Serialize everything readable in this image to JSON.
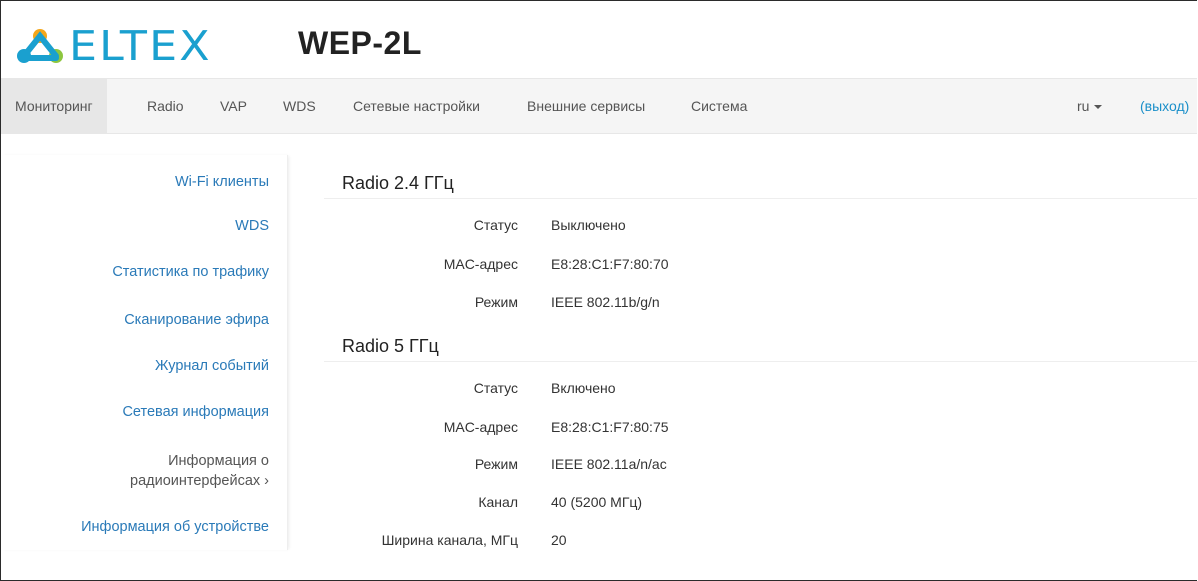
{
  "header": {
    "logo_text": "ELTEX",
    "device_title": "WEP-2L",
    "brand_color": "#1aa0cf"
  },
  "nav": {
    "items": [
      {
        "label": "Мониторинг",
        "active": true
      },
      {
        "label": "Radio",
        "active": false
      },
      {
        "label": "VAP",
        "active": false
      },
      {
        "label": "WDS",
        "active": false
      },
      {
        "label": "Сетевые настройки",
        "active": false
      },
      {
        "label": "Внешние сервисы",
        "active": false
      },
      {
        "label": "Система",
        "active": false
      }
    ],
    "language": "ru",
    "logout": "(выход)"
  },
  "sidebar": {
    "items": [
      {
        "label": "Wi-Fi клиенты"
      },
      {
        "label": "WDS"
      },
      {
        "label": "Статистика по трафику"
      },
      {
        "label": "Сканирование эфира"
      },
      {
        "label": "Журнал событий"
      },
      {
        "label": "Сетевая информация"
      },
      {
        "label_line1": "Информация о",
        "label_line2": "радиоинтерфейсах ›",
        "current": true
      },
      {
        "label": "Информация об устройстве"
      }
    ]
  },
  "radio24": {
    "title": "Radio 2.4 ГГц",
    "fields": [
      {
        "label": "Статус",
        "value": "Выключено"
      },
      {
        "label": "MAC-адрес",
        "value": "E8:28:C1:F7:80:70"
      },
      {
        "label": "Режим",
        "value": "IEEE 802.11b/g/n"
      }
    ]
  },
  "radio5": {
    "title": "Radio 5 ГГц",
    "fields": [
      {
        "label": "Статус",
        "value": "Включено"
      },
      {
        "label": "MAC-адрес",
        "value": "E8:28:C1:F7:80:75"
      },
      {
        "label": "Режим",
        "value": "IEEE 802.11a/n/ac"
      },
      {
        "label": "Канал",
        "value": "40 (5200 МГц)"
      },
      {
        "label": "Ширина канала, МГц",
        "value": "20"
      }
    ]
  },
  "colors": {
    "link": "#2a7ab8",
    "nav_bg": "#f5f5f5",
    "nav_active_bg": "#e7e7e7"
  }
}
